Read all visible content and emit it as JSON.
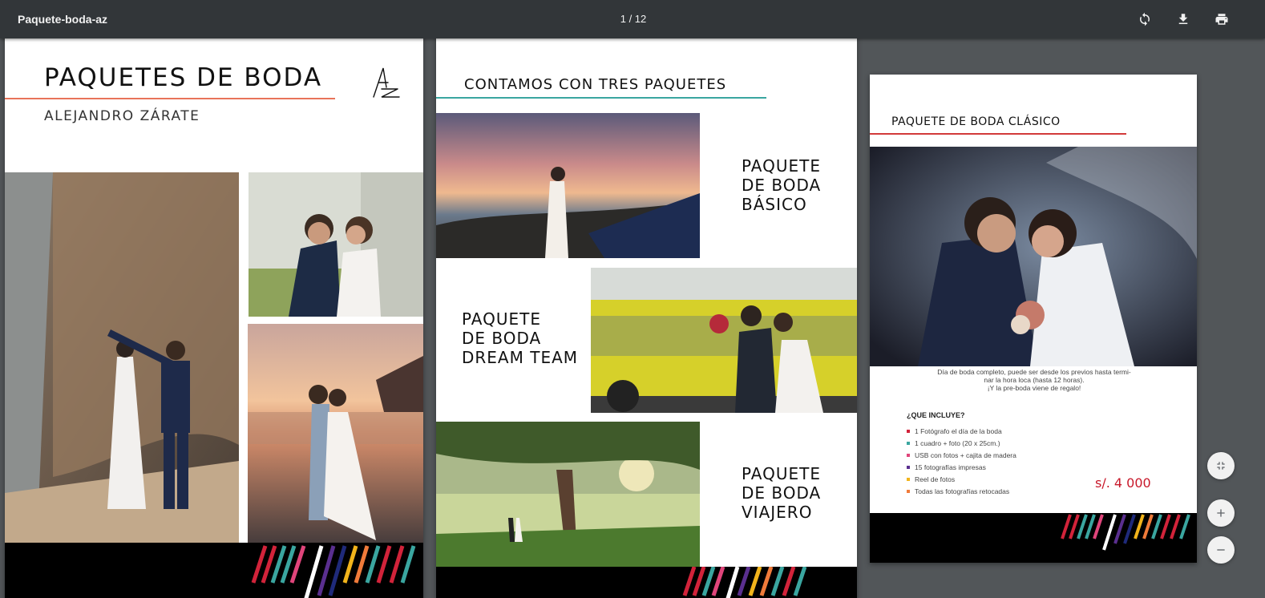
{
  "toolbar": {
    "title": "Paquete-boda-az",
    "page_indicator": "1 / 12",
    "rotate_icon": "rotate-icon",
    "download_icon": "download-icon",
    "print_icon": "print-icon"
  },
  "page1": {
    "title": "PAQUETES DE BODA",
    "subtitle": "ALEJANDRO ZÁRATE"
  },
  "page2": {
    "title": "CONTAMOS CON TRES PAQUETES",
    "packages": [
      {
        "line1": "PAQUETE",
        "line2": "DE BODA",
        "line3": "BÁSICO"
      },
      {
        "line1": "PAQUETE",
        "line2": "DE BODA",
        "line3": "DREAM TEAM"
      },
      {
        "line1": "PAQUETE",
        "line2": "DE BODA",
        "line3": "VIAJERO"
      }
    ]
  },
  "page3": {
    "title": "PAQUETE DE BODA CLÁSICO",
    "desc_line1": "Día de boda completo, puede ser desde los previos hasta termi-",
    "desc_line2": "nar la hora loca (hasta 12 horas).",
    "desc_line3": "¡Y la pre-boda viene de regalo!",
    "includes_title": "¿QUE INCLUYE?",
    "items": [
      "1 Fotógrafo el día de la boda",
      "1 cuadro + foto (20 x 25cm.)",
      "USB con fotos + cajita de madera",
      "15 fotografías impresas",
      "Reel de fotos",
      "Todas las fotografías retocadas"
    ],
    "item_colors": [
      "#d2233a",
      "#3aa6a0",
      "#e0457b",
      "#5a2f8f",
      "#f2b41b",
      "#f07b3a"
    ],
    "price": "s/. 4 000"
  },
  "zoom_controls": {
    "fit_icon": "fit-to-page-icon",
    "zoom_in_icon": "zoom-in-icon",
    "zoom_out_icon": "zoom-out-icon"
  },
  "colors": {
    "toolbar_bg": "#323639",
    "viewer_bg": "#525659",
    "accent_orange": "#e8735a",
    "accent_teal": "#3aa6a0",
    "accent_red": "#d23a3a",
    "price_red": "#c8192b"
  }
}
